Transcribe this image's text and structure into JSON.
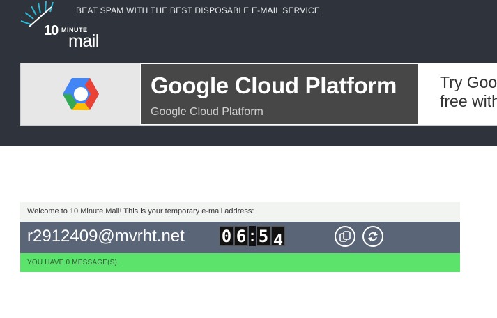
{
  "header": {
    "logo": {
      "number": "10",
      "minute": "MINUTE",
      "mail": "mail"
    },
    "tagline": "BEAT SPAM WITH THE BEST DISPOSABLE E-MAIL SERVICE"
  },
  "ad": {
    "title": "Google Cloud Platform",
    "subtitle": "Google Cloud Platform",
    "cta_line1": "Try Goo",
    "cta_line2": "free with",
    "colors": {
      "dark_panel": "#474747",
      "logo_box": "#e7e7e7"
    }
  },
  "mail_panel": {
    "welcome": "Welcome to 10 Minute Mail! This is your temporary e-mail address:",
    "address": "r2912409@mvrht.net",
    "timer": {
      "d1": "0",
      "d2": "6",
      "sep": ":",
      "d3": "5",
      "d4": "4"
    },
    "messages_status": "YOU HAVE 0 MESSAGE(S).",
    "icons": {
      "copy": "copy-icon",
      "refresh": "refresh-icon"
    },
    "colors": {
      "address_bar": "#5b6578",
      "status_bar": "#5ce36c"
    }
  }
}
